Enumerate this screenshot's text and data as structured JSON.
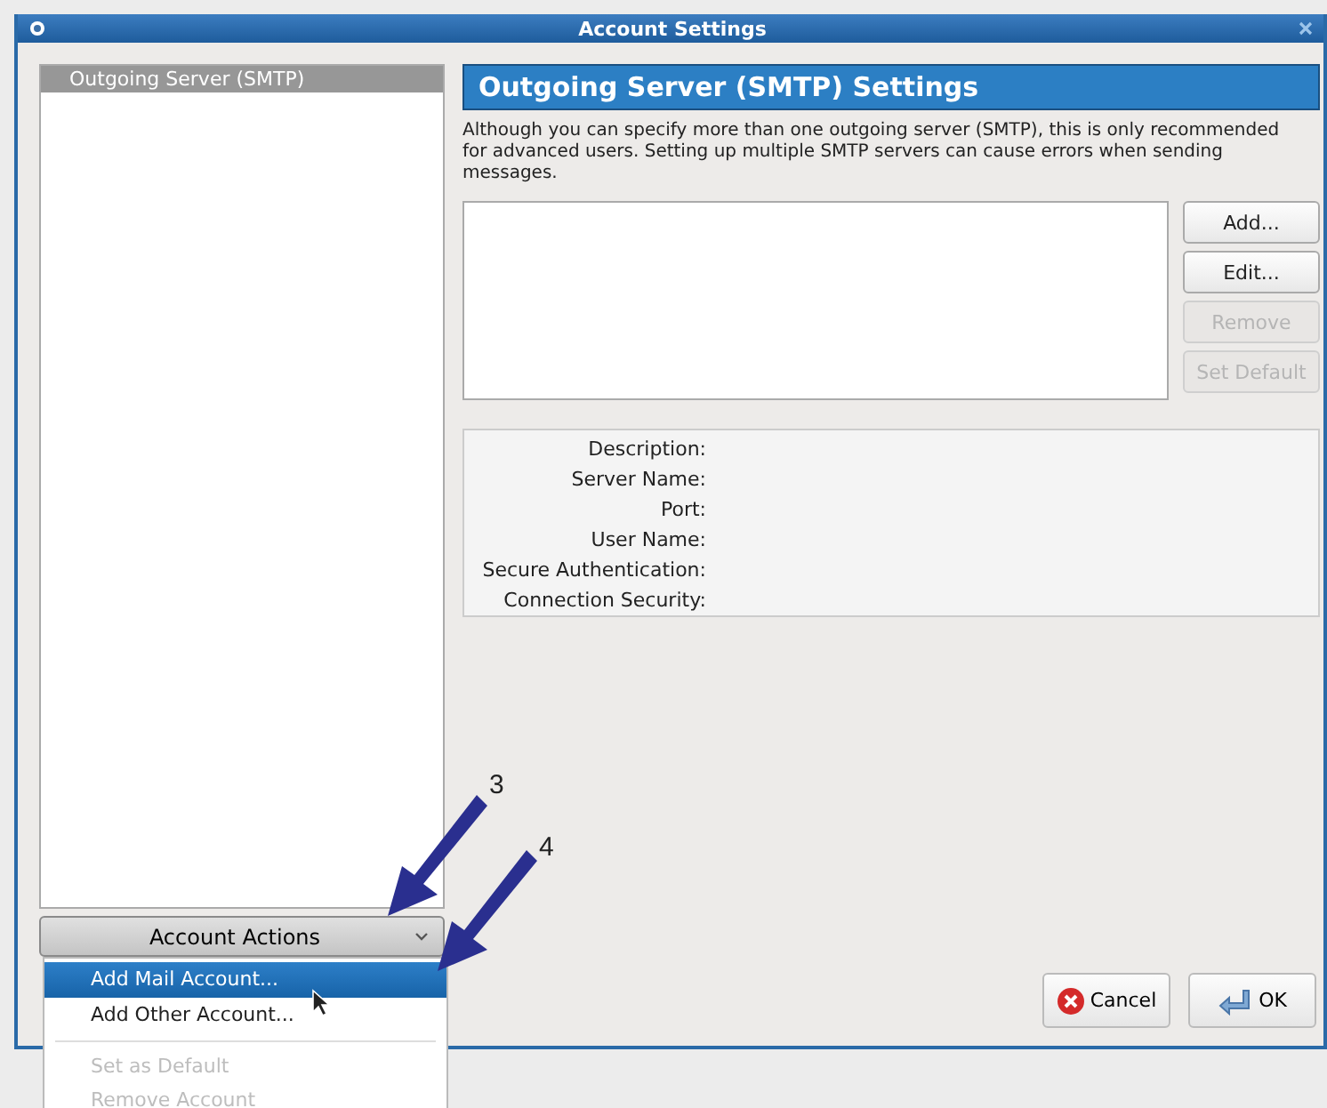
{
  "window": {
    "title": "Account Settings"
  },
  "sidebar": {
    "items": [
      {
        "label": "Outgoing Server (SMTP)",
        "selected": true
      }
    ]
  },
  "account_actions": {
    "label": "Account Actions",
    "expanded": true
  },
  "menu": {
    "items": [
      {
        "label": "Add Mail Account...",
        "selected": true,
        "disabled": false
      },
      {
        "label": "Add Other Account...",
        "selected": false,
        "disabled": false
      },
      {
        "label": "Set as Default",
        "selected": false,
        "disabled": true
      },
      {
        "label": "Remove Account",
        "selected": false,
        "disabled": true
      }
    ]
  },
  "panel": {
    "title": "Outgoing Server (SMTP) Settings",
    "description": "Although you can specify more than one outgoing server (SMTP), this is only recommended for advanced users. Setting up multiple SMTP servers can cause errors when sending messages.",
    "buttons": [
      {
        "label": "Add...",
        "disabled": false
      },
      {
        "label": "Edit...",
        "disabled": false
      },
      {
        "label": "Remove",
        "disabled": true
      },
      {
        "label": "Set Default",
        "disabled": true
      }
    ],
    "details": [
      "Description:",
      "Server Name:",
      "Port:",
      "User Name:",
      "Secure Authentication:",
      "Connection Security:"
    ]
  },
  "dialog_buttons": [
    {
      "kind": "cancel",
      "label": "Cancel"
    },
    {
      "kind": "ok",
      "label": "OK"
    }
  ],
  "annotations": [
    "3",
    "4"
  ]
}
